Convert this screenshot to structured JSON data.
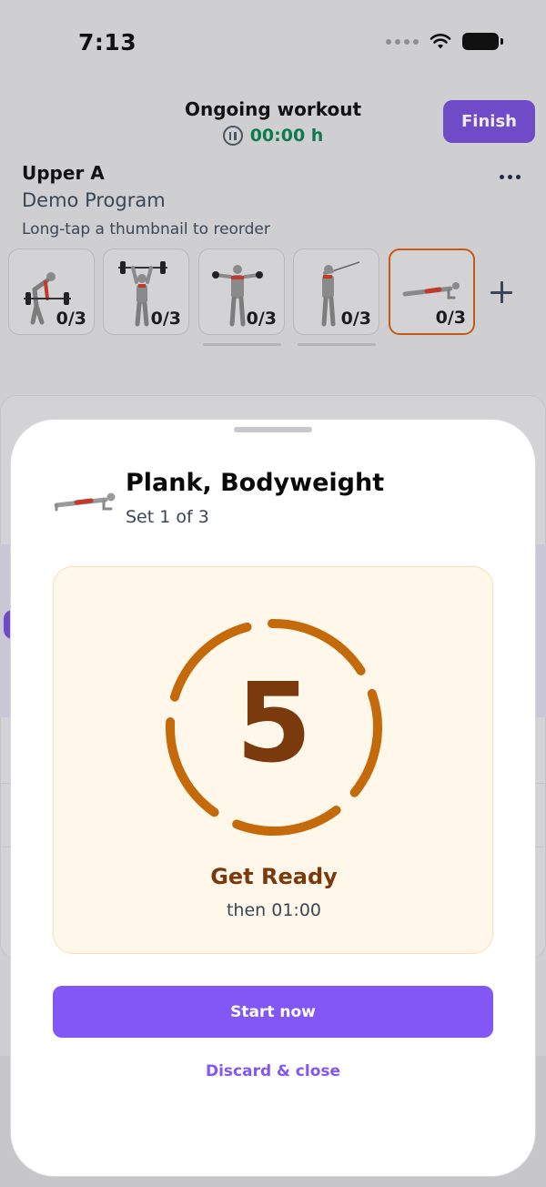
{
  "status_bar": {
    "time": "7:13",
    "icons": [
      "cellular-dots-icon",
      "wifi-icon",
      "battery-icon"
    ]
  },
  "workout": {
    "title": "Ongoing workout",
    "timer": "00:00 h",
    "finish_label": "Finish",
    "timer_color": "#0e7a4d",
    "finish_color": "#6f4bc8"
  },
  "program": {
    "name": "Upper A",
    "subtitle": "Demo Program",
    "hint": "Long-tap a thumbnail to reorder"
  },
  "exercises": [
    {
      "icon": "bent-over-row-figure-icon",
      "count": "0/3",
      "active": false
    },
    {
      "icon": "overhead-press-figure-icon",
      "count": "0/3",
      "active": false
    },
    {
      "icon": "lateral-raise-figure-icon",
      "count": "0/3",
      "active": false
    },
    {
      "icon": "cable-raise-figure-icon",
      "count": "0/3",
      "active": false
    },
    {
      "icon": "plank-figure-icon",
      "count": "0/3",
      "active": true
    }
  ],
  "sheet": {
    "exercise_name": "Plank, Bodyweight",
    "set_label": "Set 1 of 3",
    "countdown": "5",
    "countdown_progress": 1.0,
    "ready_label": "Get Ready",
    "then_label": "then 01:00",
    "start_label": "Start now",
    "discard_label": "Discard & close",
    "accent_color": "#8257f5",
    "ring_color": "#c46a0a",
    "card_bg": "#fef7ea"
  }
}
